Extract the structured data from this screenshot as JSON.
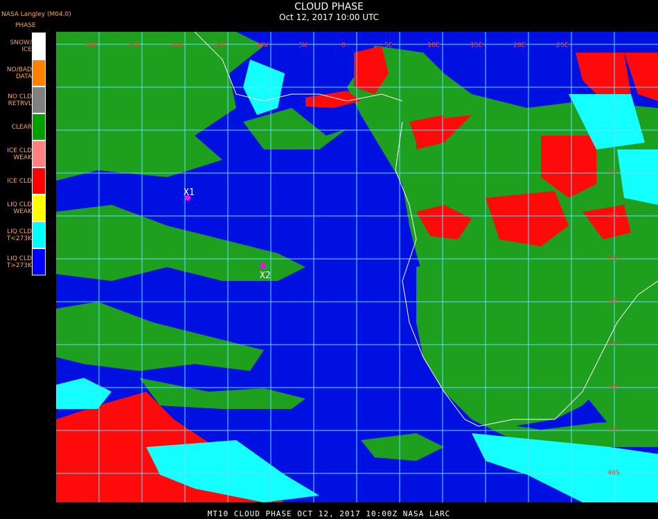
{
  "header": {
    "title": "CLOUD PHASE",
    "subtitle": "Oct 12, 2017 10:00 UTC",
    "provider": "NASA Langley (M04.0)"
  },
  "legend": {
    "title": "PHASE",
    "items": [
      {
        "label": "SNOW/\nICE",
        "color": "#ffffff"
      },
      {
        "label": "NO/BAD\nDATA",
        "color": "#ff8000"
      },
      {
        "label": "NO CLD\nRETRVL",
        "color": "#808080"
      },
      {
        "label": "CLEAR",
        "color": "#00a000"
      },
      {
        "label": "ICE CLD\nWEAK",
        "color": "#ff8080"
      },
      {
        "label": "ICE CLD",
        "color": "#ff0000"
      },
      {
        "label": "LIQ CLD\nWEAK",
        "color": "#ffff00"
      },
      {
        "label": "LIQ CLD\nT<273K",
        "color": "#00ffff"
      },
      {
        "label": "LIQ CLD\nT>273K",
        "color": "#0000ff"
      }
    ]
  },
  "map": {
    "grid_labels_top": [
      "30W",
      "25W",
      "20W",
      "15W",
      "10W",
      "5W",
      "0",
      "5E",
      "10E",
      "15E",
      "20E",
      "25E"
    ],
    "grid_labels_right": [
      "5S",
      "10S",
      "15S",
      "20S",
      "25S",
      "30S",
      "35S",
      "40S"
    ],
    "markers": [
      {
        "label": "X1",
        "color": "#ff00ff"
      },
      {
        "label": "X2",
        "color": "#ff00ff"
      }
    ],
    "colors": {
      "ocean_liq": "#0010e0",
      "clear": "#1ea01e",
      "ice": "#ff0a0a",
      "liq_cold": "#14ffff",
      "grid": "#5fe0ff"
    }
  },
  "footer": {
    "text": "MT10  CLOUD PHASE   OCT 12, 2017 10:00Z   NASA LARC"
  }
}
